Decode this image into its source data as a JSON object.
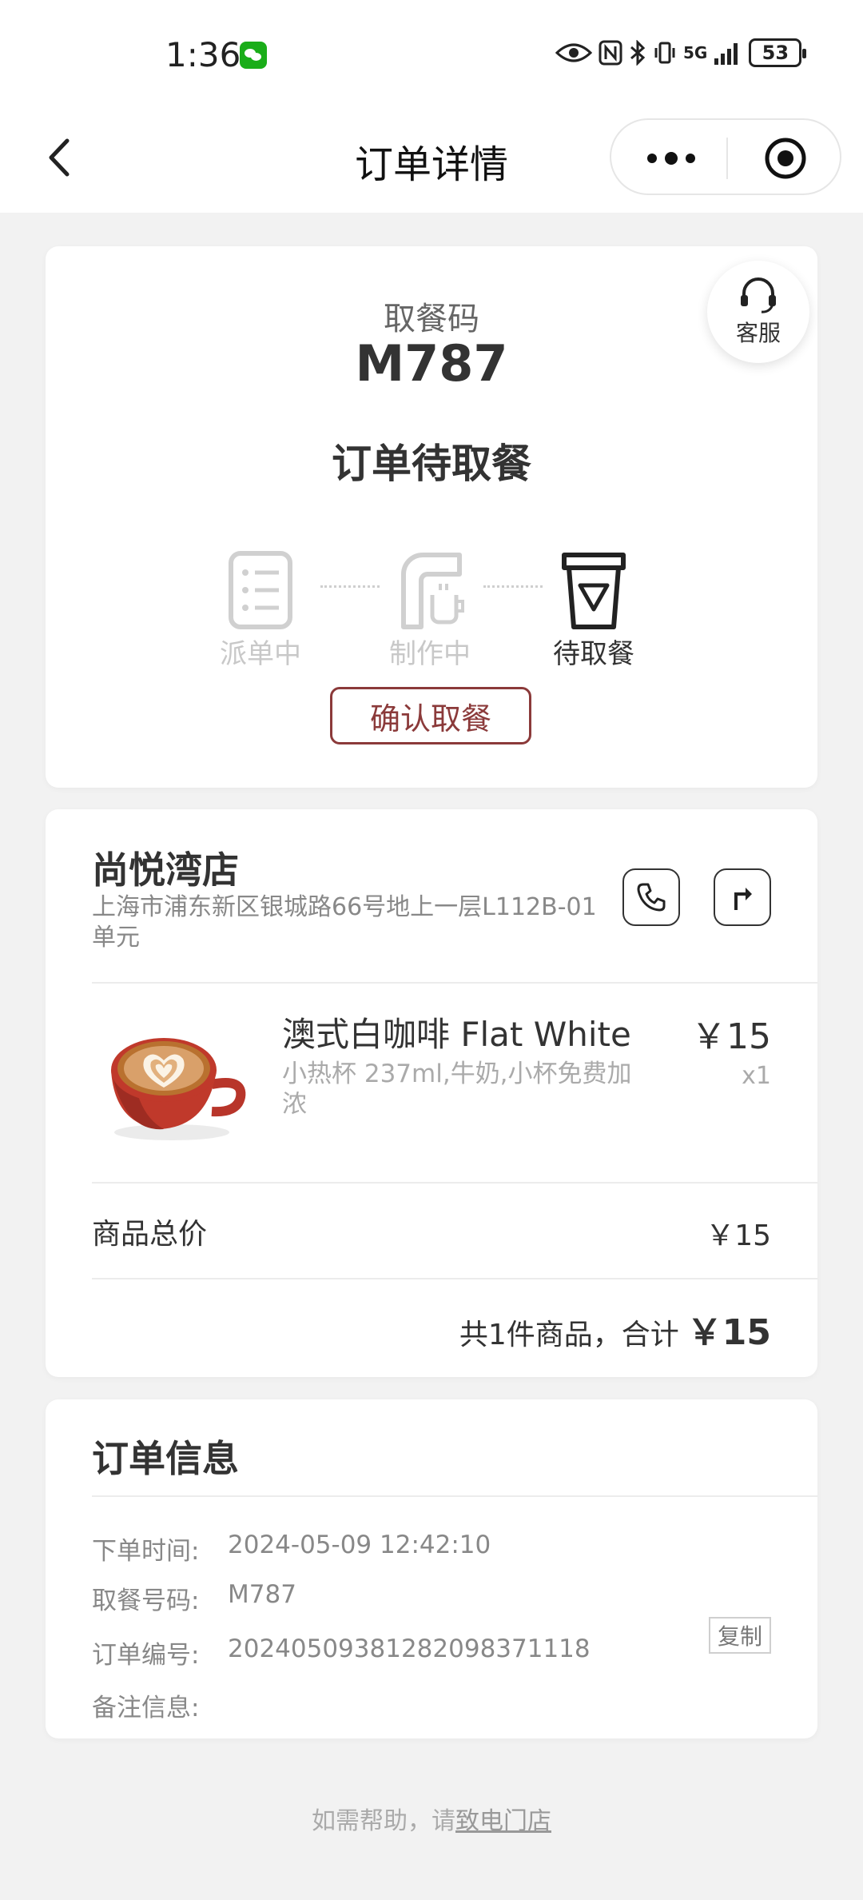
{
  "status_bar": {
    "time": "1:36",
    "network": "5G",
    "battery": "53"
  },
  "nav": {
    "title": "订单详情"
  },
  "pickup": {
    "label": "取餐码",
    "code": "M787",
    "status": "订单待取餐",
    "service_label": "客服",
    "steps": [
      {
        "label": "派单中",
        "state": "inactive",
        "icon": "list-icon"
      },
      {
        "label": "制作中",
        "state": "inactive",
        "icon": "coffee-machine-icon"
      },
      {
        "label": "待取餐",
        "state": "active",
        "icon": "cup-icon"
      }
    ],
    "confirm_label": "确认取餐"
  },
  "store": {
    "name": "尚悦湾店",
    "address": "上海市浦东新区银城路66号地上一层L112B-01单元",
    "product": {
      "name": "澳式白咖啡 Flat White",
      "price": "￥15",
      "spec": "小热杯 237ml,牛奶,小杯免费加浓",
      "qty": "x1"
    },
    "subtotal_label": "商品总价",
    "subtotal_value": "￥15",
    "total_prefix": "共1件商品，合计",
    "total_amount": "￥15"
  },
  "order_info": {
    "title": "订单信息",
    "rows": [
      {
        "key": "下单时间:",
        "value": "2024-05-09 12:42:10"
      },
      {
        "key": "取餐号码:",
        "value": "M787"
      },
      {
        "key": "订单编号:",
        "value": "20240509381282098371118"
      },
      {
        "key": "备注信息:",
        "value": ""
      }
    ],
    "copy_label": "复制"
  },
  "footer": {
    "text": "如需帮助，请",
    "link": "致电门店"
  },
  "colors": {
    "accent": "#8b3a3a",
    "background": "#f2f2f2"
  }
}
